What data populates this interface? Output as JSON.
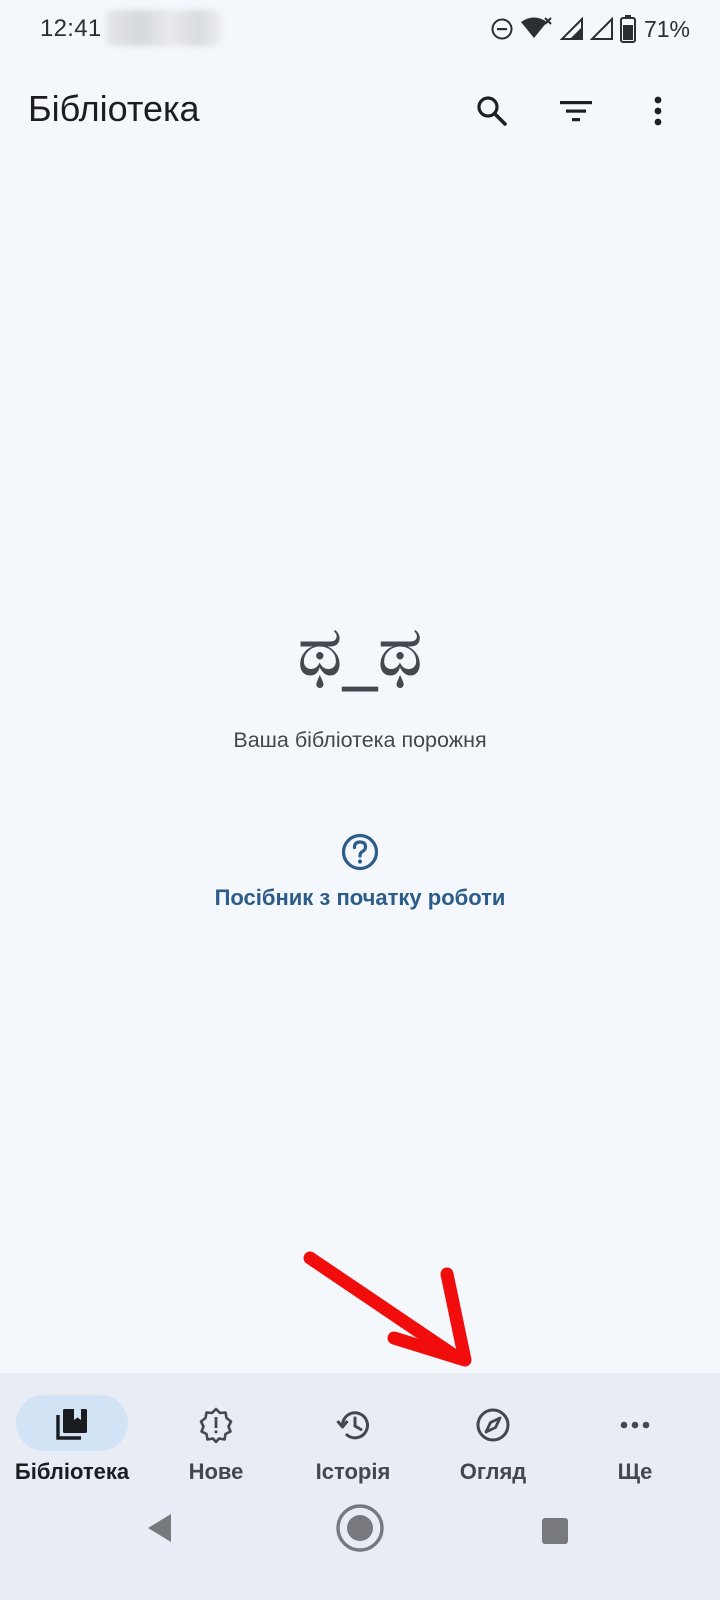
{
  "status_bar": {
    "time": "12:41",
    "battery_percent": "71%",
    "icons": [
      "do-not-disturb-icon",
      "wifi-no-internet-icon",
      "signal-icon",
      "signal-icon",
      "battery-icon"
    ]
  },
  "app_bar": {
    "title": "Бібліотека",
    "actions": [
      "search-icon",
      "filter-icon",
      "more-vert-icon"
    ]
  },
  "empty_state": {
    "face": "ಥ_ಥ",
    "message": "Ваша бібліотека порожня",
    "guide_icon": "help-circle-icon",
    "guide_label": "Посібник з початку роботи"
  },
  "bottom_nav": {
    "active_index": 0,
    "items": [
      {
        "label": "Бібліотека",
        "icon": "library-icon"
      },
      {
        "label": "Нове",
        "icon": "new-updates-icon"
      },
      {
        "label": "Історія",
        "icon": "history-icon"
      },
      {
        "label": "Огляд",
        "icon": "explore-icon"
      },
      {
        "label": "Ще",
        "icon": "more-horiz-icon"
      }
    ]
  },
  "system_nav": [
    "back-icon",
    "home-icon",
    "recents-icon"
  ],
  "annotation": {
    "type": "red-arrow",
    "color": "#f20d0d",
    "points_to": "Огляд"
  },
  "colors": {
    "background": "#f4f8fd",
    "nav_background": "#e8edf5",
    "active_pill": "#d2e3f6",
    "link": "#2b5c8a"
  }
}
